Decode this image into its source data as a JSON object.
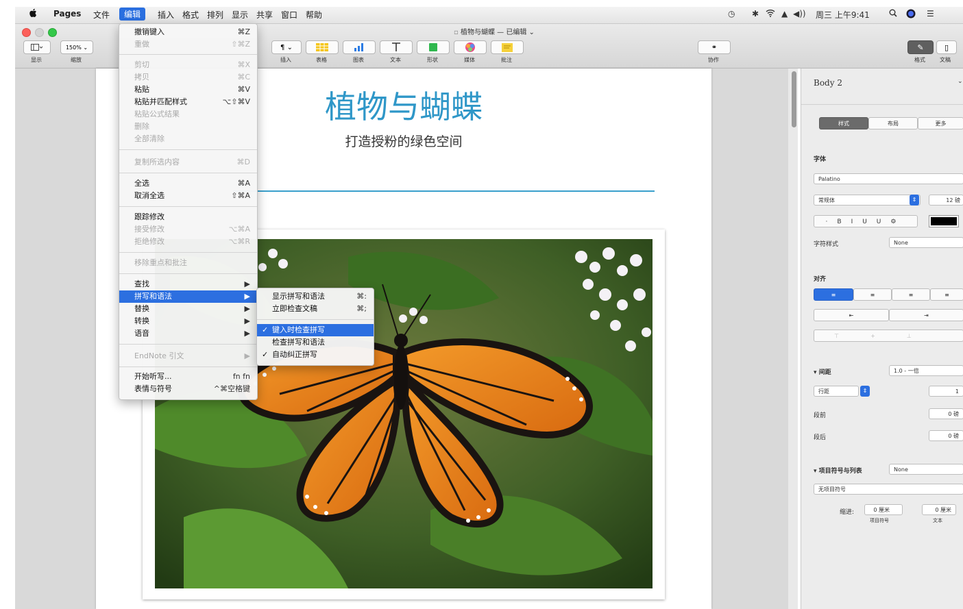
{
  "menubar": {
    "apple": "",
    "app_name": "Pages",
    "items": [
      "文件",
      "编辑",
      "插入",
      "格式",
      "排列",
      "显示",
      "共享",
      "窗口",
      "帮助"
    ],
    "clock": "周三 上午9:41"
  },
  "window": {
    "title": "植物与蝴蝶 — 已编辑",
    "toolbar": {
      "view_label": "显示",
      "zoom_value": "150%",
      "zoom_label": "缩放",
      "insert_label": "插入",
      "table_label": "表格",
      "chart_label": "图表",
      "text_label": "文本",
      "shape_label": "形状",
      "media_label": "媒体",
      "comment_label": "批注",
      "collaborate_label": "协作",
      "format_label": "格式",
      "document_label": "文稿"
    }
  },
  "document": {
    "heading": "植物与蝴蝶",
    "subtitle": "打造授粉的绿色空间"
  },
  "edit_menu": {
    "items": [
      {
        "label": "撤销键入",
        "shortcut": "⌘Z",
        "enabled": true
      },
      {
        "label": "重做",
        "shortcut": "⇧⌘Z",
        "enabled": false
      },
      {
        "label": "剪切",
        "shortcut": "⌘X",
        "enabled": false
      },
      {
        "label": "拷贝",
        "shortcut": "⌘C",
        "enabled": false
      },
      {
        "label": "粘贴",
        "shortcut": "⌘V",
        "enabled": true
      },
      {
        "label": "粘贴并匹配样式",
        "shortcut": "⌥⇧⌘V",
        "enabled": true
      },
      {
        "label": "粘贴公式结果",
        "shortcut": "",
        "enabled": false
      },
      {
        "label": "删除",
        "shortcut": "",
        "enabled": false
      },
      {
        "label": "全部清除",
        "shortcut": "",
        "enabled": false
      },
      {
        "label": "复制所选内容",
        "shortcut": "⌘D",
        "enabled": false
      },
      {
        "label": "全选",
        "shortcut": "⌘A",
        "enabled": true
      },
      {
        "label": "取消全选",
        "shortcut": "⇧⌘A",
        "enabled": true
      },
      {
        "label": "跟踪修改",
        "shortcut": "",
        "enabled": true
      },
      {
        "label": "接受修改",
        "shortcut": "⌥⌘A",
        "enabled": false
      },
      {
        "label": "拒绝修改",
        "shortcut": "⌥⌘R",
        "enabled": false
      },
      {
        "label": "移除重点和批注",
        "shortcut": "",
        "enabled": false
      },
      {
        "label": "查找",
        "shortcut": "▶",
        "enabled": true
      },
      {
        "label": "拼写和语法",
        "shortcut": "▶",
        "enabled": true,
        "highlighted": true
      },
      {
        "label": "替换",
        "shortcut": "▶",
        "enabled": true
      },
      {
        "label": "转换",
        "shortcut": "▶",
        "enabled": true
      },
      {
        "label": "语音",
        "shortcut": "▶",
        "enabled": true
      },
      {
        "label": "EndNote 引文",
        "shortcut": "▶",
        "enabled": false
      },
      {
        "label": "开始听写...",
        "shortcut": "fn fn",
        "enabled": true
      },
      {
        "label": "表情与符号",
        "shortcut": "^⌘空格键",
        "enabled": true
      }
    ]
  },
  "spelling_submenu": {
    "items": [
      {
        "label": "显示拼写和语法",
        "shortcut": "⌘:",
        "checked": false
      },
      {
        "label": "立即检查文稿",
        "shortcut": "⌘;",
        "checked": false
      },
      {
        "label": "键入时检查拼写",
        "shortcut": "",
        "checked": true,
        "highlighted": true
      },
      {
        "label": "检查拼写和语法",
        "shortcut": "",
        "checked": false
      },
      {
        "label": "自动纠正拼写",
        "shortcut": "",
        "checked": true
      }
    ]
  },
  "inspector": {
    "style_name": "Body 2",
    "tabs": [
      "样式",
      "布局",
      "更多"
    ],
    "font_label": "字体",
    "font_family": "Palatino",
    "font_style": "常规体",
    "font_size": "12 磅",
    "char_style_label": "字符样式",
    "char_style_value": "None",
    "align_label": "对齐",
    "spacing_label": "间距",
    "spacing_value": "1.0 - 一倍",
    "line_label": "行距",
    "line_value": "1",
    "before_label": "段前",
    "before_value": "0 磅",
    "after_label": "段后",
    "after_value": "0 磅",
    "bullets_label": "项目符号与列表",
    "bullets_value": "None",
    "bullet_style": "无项目符号",
    "indent_label": "缩进:",
    "indent_bullet_value": "0 厘米",
    "indent_text_value": "0 厘米",
    "indent_bullet_caption": "项目符号",
    "indent_text_caption": "文本",
    "text_color": "#000000"
  },
  "colors": {
    "accent": "#2c6fe0",
    "heading": "#2f97c8",
    "rule": "#3aa0cc"
  }
}
